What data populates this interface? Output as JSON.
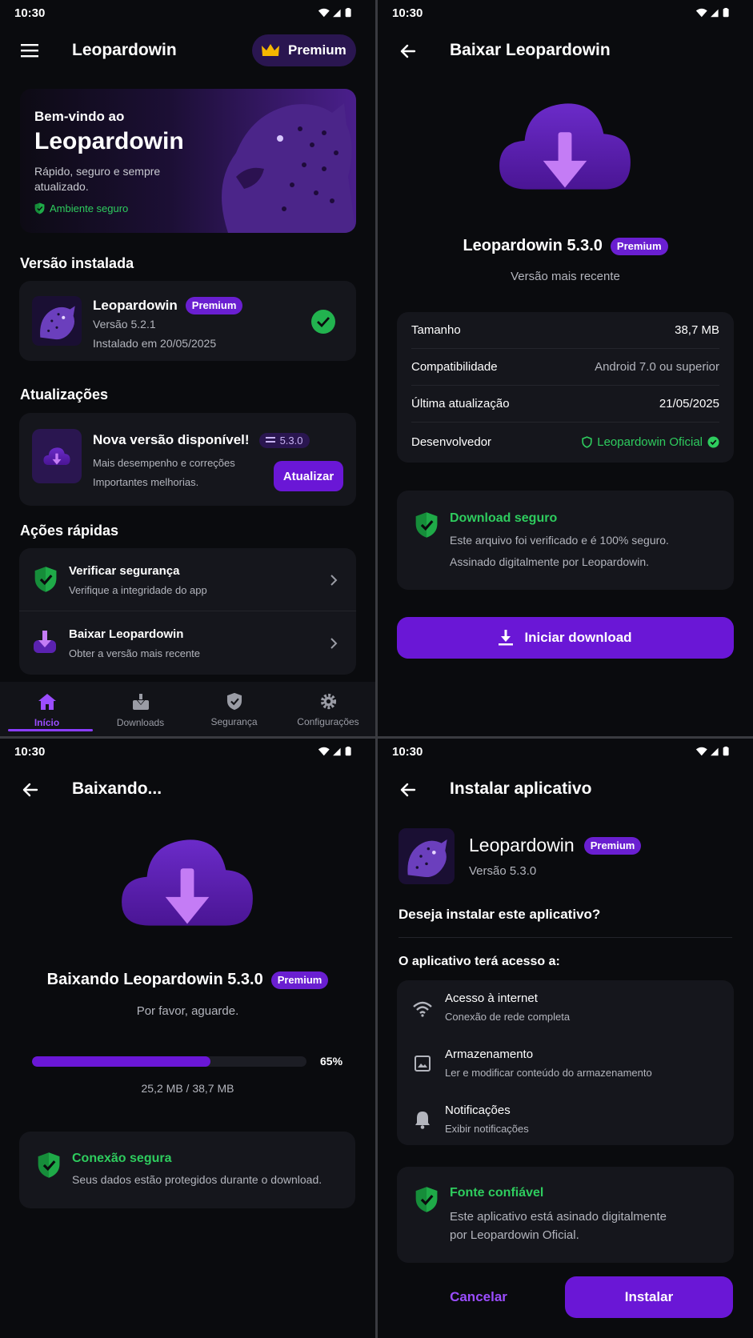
{
  "status": {
    "time": "10:30"
  },
  "home": {
    "app_title": "Leopardowin",
    "premium_label": "Premium",
    "hero": {
      "welcome": "Bem-vindo ao",
      "name": "Leopardowin",
      "desc": "Rápido, seguro e sempre atualizado.",
      "safe": "Ambiente seguro"
    },
    "installed": {
      "section": "Versão instalada",
      "name": "Leopardowin",
      "badge": "Premium",
      "version": "Versão 5.2.1",
      "date": "Instalado em 20/05/2025"
    },
    "updates": {
      "section": "Atualizações",
      "title": "Nova versão disponível!",
      "version": "5.3.0",
      "line1": "Mais desempenho e correções",
      "line2": "Importantes melhorias.",
      "button": "Atualizar"
    },
    "quick": {
      "section": "Ações rápidas",
      "items": [
        {
          "title": "Verificar segurança",
          "sub": "Verifique a integridade do app"
        },
        {
          "title": "Baixar Leopardowin",
          "sub": "Obter a versão mais recente"
        }
      ]
    },
    "nav": [
      {
        "label": "Início",
        "active": true
      },
      {
        "label": "Downloads"
      },
      {
        "label": "Segurança"
      },
      {
        "label": "Configurações"
      }
    ]
  },
  "download": {
    "title": "Baixar Leopardowin",
    "app_version": "Leopardowin 5.3.0",
    "badge": "Premium",
    "subtitle": "Versão mais recente",
    "details": [
      {
        "label": "Tamanho",
        "value": "38,7 MB"
      },
      {
        "label": "Compatibilidade",
        "value": "Android 7.0 ou superior"
      },
      {
        "label": "Última atualização",
        "value": "21/05/2025"
      },
      {
        "label": "Desenvolvedor",
        "value": "Leopardowin Oficial"
      }
    ],
    "safe": {
      "title": "Download seguro",
      "line1": "Este arquivo foi verificado e é 100% seguro.",
      "line2": "Assinado digitalmente por Leopardowin."
    },
    "button": "Iniciar download"
  },
  "downloading": {
    "title": "Baixando...",
    "heading": "Baixando Leopardowin 5.3.0",
    "badge": "Premium",
    "wait": "Por favor, aguarde.",
    "progress": 0.65,
    "percent": "65%",
    "amount": "25,2 MB / 38,7 MB",
    "secure": {
      "title": "Conexão segura",
      "text": "Seus dados estão protegidos durante o download."
    }
  },
  "install": {
    "title": "Instalar aplicativo",
    "name": "Leopardowin",
    "badge": "Premium",
    "version": "Versão 5.3.0",
    "question": "Deseja instalar este aplicativo?",
    "access_title": "O aplicativo terá acesso a:",
    "permissions": [
      {
        "icon": "wifi-icon",
        "title": "Acesso à internet",
        "sub": "Conexão de rede completa"
      },
      {
        "icon": "image-icon",
        "title": "Armazenamento",
        "sub": "Ler e modificar conteúdo do armazenamento"
      },
      {
        "icon": "bell-icon",
        "title": "Notificações",
        "sub": "Exibir notificações"
      }
    ],
    "trusted": {
      "title": "Fonte confiável",
      "line1": "Este aplicativo está asinado digitalmente",
      "line2": "por Leopardowin Oficial."
    },
    "cancel": "Cancelar",
    "install": "Instalar"
  },
  "colors": {
    "accent": "#6a17d6",
    "green": "#2ecc5e",
    "bg": "#0a0b0e",
    "card": "#15161c"
  }
}
